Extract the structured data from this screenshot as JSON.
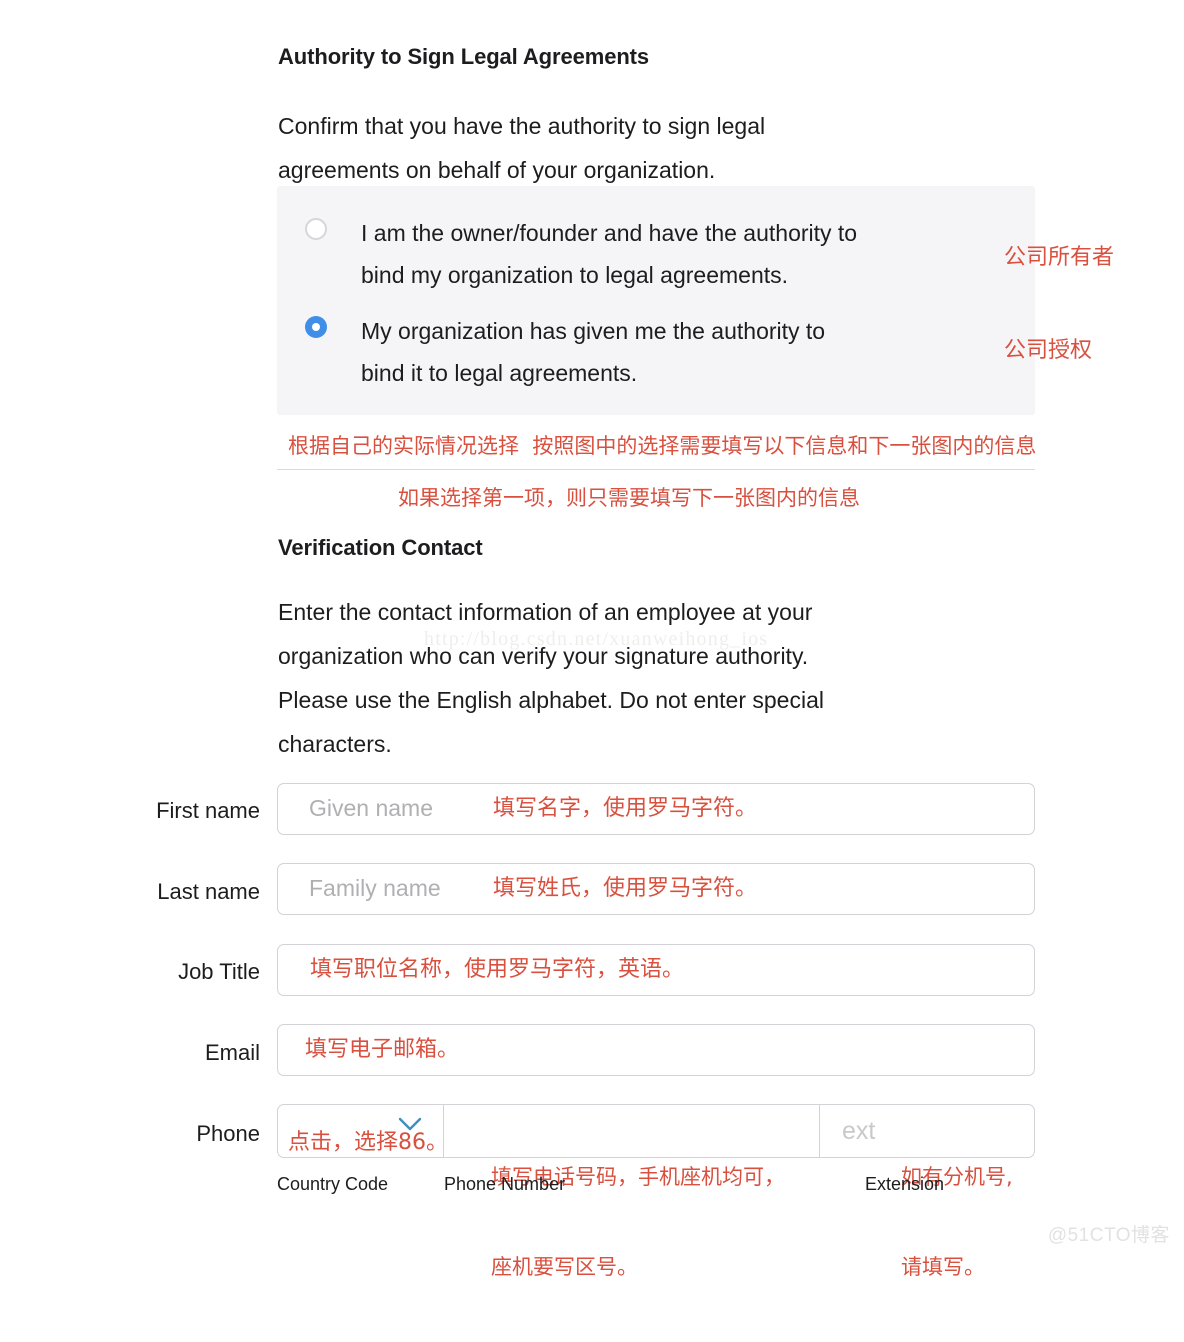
{
  "section": {
    "title": "Authority to Sign Legal Agreements",
    "description_line1": "Confirm that you have the authority to sign legal",
    "description_line2": "agreements on behalf of your organization."
  },
  "authority_options": [
    {
      "selected": false,
      "line1": "I am the owner/founder and have the authority to",
      "line2": "bind my organization to legal agreements.",
      "annotation": "公司所有者"
    },
    {
      "selected": true,
      "line1": "My organization has given me the authority to",
      "line2": "bind it to legal agreements.",
      "annotation": "公司授权"
    }
  ],
  "notes": {
    "above_divider": "根据自己的实际情况选择  按照图中的选择需要填写以下信息和下一张图内的信息",
    "below_divider": "如果选择第一项，则只需要填写下一张图内的信息"
  },
  "verification": {
    "title": "Verification Contact",
    "description_line1": "Enter the contact information of an employee at your",
    "description_line2": "organization who can verify your signature authority.",
    "description_line3": "Please use the English alphabet. Do not enter special",
    "description_line4": "characters."
  },
  "form": {
    "fields": [
      {
        "label": "First name",
        "placeholder": "Given name",
        "value": "",
        "annotation": "填写名字，使用罗马字符。"
      },
      {
        "label": "Last name",
        "placeholder": "Family name",
        "value": "",
        "annotation": "填写姓氏，使用罗马字符。"
      },
      {
        "label": "Job Title",
        "placeholder": "",
        "value": "",
        "annotation": "填写职位名称，使用罗马字符，英语。"
      },
      {
        "label": "Email",
        "placeholder": "",
        "value": "",
        "annotation": "填写电子邮箱。"
      }
    ],
    "phone": {
      "label": "Phone",
      "country_code": {
        "sub_label": "Country Code",
        "value": "",
        "annotation": "点击，选择86。"
      },
      "phone_number": {
        "sub_label": "Phone Number",
        "value": "",
        "annotation_line1": "填写电话号码，手机座机均可，",
        "annotation_line2": "座机要写区号。"
      },
      "extension": {
        "sub_label": "Extension",
        "placeholder": "ext",
        "value": "",
        "annotation_line1": "如有分机号,",
        "annotation_line2": "请填写。"
      }
    }
  },
  "watermarks": {
    "middle": "http://blog.csdn.net/xuanweihong_ios",
    "bottom_right": "@51CTO博客"
  },
  "colors": {
    "accent": "#3f8fe8",
    "annotation": "#d9503f",
    "panel": "#f5f5f7",
    "border": "#d2d2d7"
  }
}
